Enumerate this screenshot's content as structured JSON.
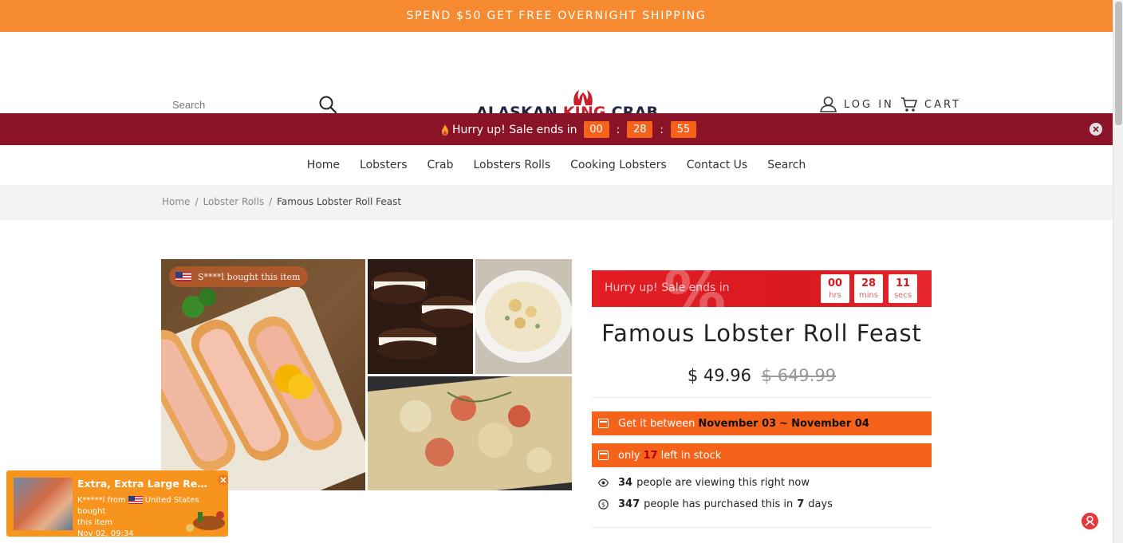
{
  "promo": {
    "text": "SPEND $50 GET FREE OVERNIGHT SHIPPING"
  },
  "header": {
    "search_placeholder": "Search",
    "logo_text_1": "ALASKAN ",
    "logo_text_k": "KING",
    "logo_text_2": " CRAB",
    "login_label": "LOG IN",
    "cart_label": "CART"
  },
  "sale_bar": {
    "label": "Hurry up! Sale ends in",
    "hours": "00",
    "minutes": "28",
    "seconds": "55"
  },
  "nav": {
    "items": [
      "Home",
      "Lobsters",
      "Crab",
      "Lobsters Rolls",
      "Cooking Lobsters",
      "Contact Us",
      "Search"
    ]
  },
  "breadcrumb": {
    "home": "Home",
    "sep": "/",
    "category": "Lobster Rolls",
    "current": "Famous Lobster Roll Feast"
  },
  "gallery": {
    "bought_text": "S****l bought this item"
  },
  "product": {
    "banner_hurry": "Hurry up! Sale ends in",
    "timer": [
      {
        "n": "00",
        "u": "hrs"
      },
      {
        "n": "28",
        "u": "mins"
      },
      {
        "n": "11",
        "u": "secs"
      }
    ],
    "title": "Famous Lobster Roll Feast",
    "price_now": "$ 49.96",
    "price_was": "$ 649.99",
    "delivery_prefix": "Get it between",
    "delivery_from": "November 03",
    "delivery_sep": "~",
    "delivery_to": "November 04",
    "stock_prefix": "only",
    "stock_count": "17",
    "stock_suffix": "left in stock",
    "viewing_count": "34",
    "viewing_text": "people are viewing this right now",
    "purchased_count": "347",
    "purchased_text": "people has purchased this in",
    "purchased_days": "7",
    "purchased_unit": "days"
  },
  "toast": {
    "title": "Extra, Extra Large Red King ...",
    "buyer": "K*****l from",
    "country": "United States bought",
    "line2": "this item",
    "time": "Nov 02, 09:34"
  },
  "colors": {
    "promo": "#f58a30",
    "sale_bar": "#8b1328",
    "accent_orange": "#f5631b",
    "banner_red": "#e31e24"
  }
}
